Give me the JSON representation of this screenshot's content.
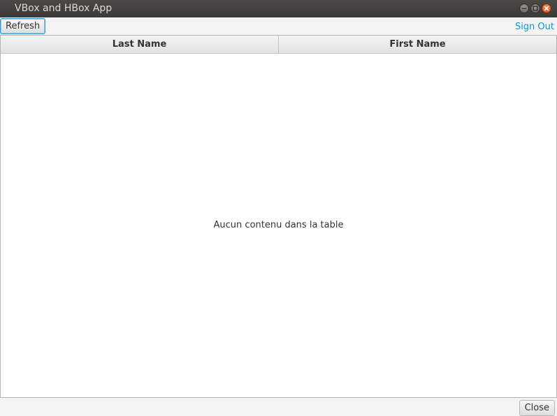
{
  "window": {
    "title": "VBox and HBox App",
    "controls": [
      "minimize-icon",
      "maximize-icon",
      "close-icon"
    ],
    "close_color": "#d84b1c"
  },
  "toolbar": {
    "refresh_label": "Refresh",
    "signout_label": "Sign Out",
    "link_color": "#0e96d1"
  },
  "table": {
    "columns": [
      "Last Name",
      "First Name"
    ],
    "rows": [],
    "empty_message": "Aucun contenu dans la table"
  },
  "footer": {
    "close_label": "Close"
  }
}
